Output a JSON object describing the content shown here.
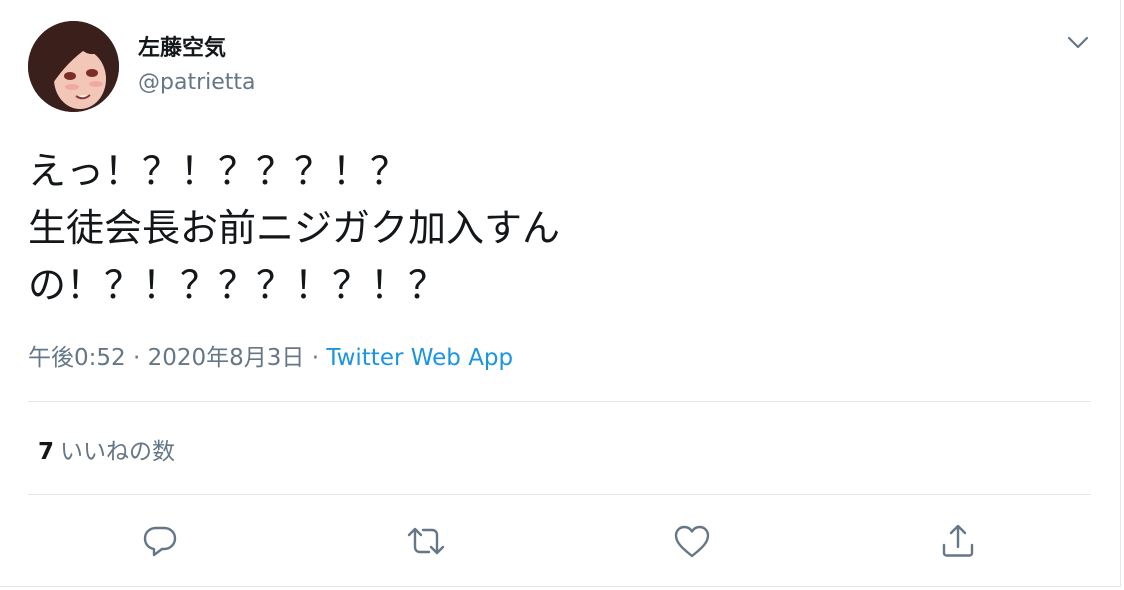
{
  "tweet": {
    "display_name": "左藤空気",
    "handle": "@patrietta",
    "text_lines": [
      "えっ！？！？？？！？",
      "生徒会長お前ニジガク加入すん",
      "の！？！？？？！？！？"
    ],
    "time": "午後0:52",
    "separator": "·",
    "date": "2020年8月3日",
    "source": "Twitter Web App",
    "likes_count": "7",
    "likes_label": "いいねの数"
  },
  "icons": {
    "caret": "chevron-down-icon",
    "reply": "reply-icon",
    "retweet": "retweet-icon",
    "like": "heart-icon",
    "share": "share-icon"
  },
  "colors": {
    "text": "#14171a",
    "secondary": "#657786",
    "link": "#1b95e0",
    "divider": "#e1e8ed",
    "icon": "#657786"
  }
}
